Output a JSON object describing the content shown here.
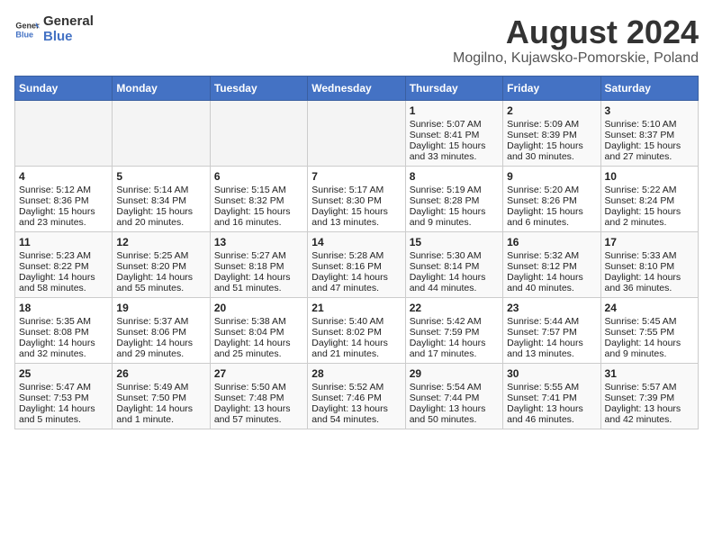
{
  "header": {
    "logo_general": "General",
    "logo_blue": "Blue",
    "main_title": "August 2024",
    "subtitle": "Mogilno, Kujawsko-Pomorskie, Poland"
  },
  "weekdays": [
    "Sunday",
    "Monday",
    "Tuesday",
    "Wednesday",
    "Thursday",
    "Friday",
    "Saturday"
  ],
  "weeks": [
    [
      {
        "day": "",
        "info": ""
      },
      {
        "day": "",
        "info": ""
      },
      {
        "day": "",
        "info": ""
      },
      {
        "day": "",
        "info": ""
      },
      {
        "day": "1",
        "info": "Sunrise: 5:07 AM\nSunset: 8:41 PM\nDaylight: 15 hours\nand 33 minutes."
      },
      {
        "day": "2",
        "info": "Sunrise: 5:09 AM\nSunset: 8:39 PM\nDaylight: 15 hours\nand 30 minutes."
      },
      {
        "day": "3",
        "info": "Sunrise: 5:10 AM\nSunset: 8:37 PM\nDaylight: 15 hours\nand 27 minutes."
      }
    ],
    [
      {
        "day": "4",
        "info": "Sunrise: 5:12 AM\nSunset: 8:36 PM\nDaylight: 15 hours\nand 23 minutes."
      },
      {
        "day": "5",
        "info": "Sunrise: 5:14 AM\nSunset: 8:34 PM\nDaylight: 15 hours\nand 20 minutes."
      },
      {
        "day": "6",
        "info": "Sunrise: 5:15 AM\nSunset: 8:32 PM\nDaylight: 15 hours\nand 16 minutes."
      },
      {
        "day": "7",
        "info": "Sunrise: 5:17 AM\nSunset: 8:30 PM\nDaylight: 15 hours\nand 13 minutes."
      },
      {
        "day": "8",
        "info": "Sunrise: 5:19 AM\nSunset: 8:28 PM\nDaylight: 15 hours\nand 9 minutes."
      },
      {
        "day": "9",
        "info": "Sunrise: 5:20 AM\nSunset: 8:26 PM\nDaylight: 15 hours\nand 6 minutes."
      },
      {
        "day": "10",
        "info": "Sunrise: 5:22 AM\nSunset: 8:24 PM\nDaylight: 15 hours\nand 2 minutes."
      }
    ],
    [
      {
        "day": "11",
        "info": "Sunrise: 5:23 AM\nSunset: 8:22 PM\nDaylight: 14 hours\nand 58 minutes."
      },
      {
        "day": "12",
        "info": "Sunrise: 5:25 AM\nSunset: 8:20 PM\nDaylight: 14 hours\nand 55 minutes."
      },
      {
        "day": "13",
        "info": "Sunrise: 5:27 AM\nSunset: 8:18 PM\nDaylight: 14 hours\nand 51 minutes."
      },
      {
        "day": "14",
        "info": "Sunrise: 5:28 AM\nSunset: 8:16 PM\nDaylight: 14 hours\nand 47 minutes."
      },
      {
        "day": "15",
        "info": "Sunrise: 5:30 AM\nSunset: 8:14 PM\nDaylight: 14 hours\nand 44 minutes."
      },
      {
        "day": "16",
        "info": "Sunrise: 5:32 AM\nSunset: 8:12 PM\nDaylight: 14 hours\nand 40 minutes."
      },
      {
        "day": "17",
        "info": "Sunrise: 5:33 AM\nSunset: 8:10 PM\nDaylight: 14 hours\nand 36 minutes."
      }
    ],
    [
      {
        "day": "18",
        "info": "Sunrise: 5:35 AM\nSunset: 8:08 PM\nDaylight: 14 hours\nand 32 minutes."
      },
      {
        "day": "19",
        "info": "Sunrise: 5:37 AM\nSunset: 8:06 PM\nDaylight: 14 hours\nand 29 minutes."
      },
      {
        "day": "20",
        "info": "Sunrise: 5:38 AM\nSunset: 8:04 PM\nDaylight: 14 hours\nand 25 minutes."
      },
      {
        "day": "21",
        "info": "Sunrise: 5:40 AM\nSunset: 8:02 PM\nDaylight: 14 hours\nand 21 minutes."
      },
      {
        "day": "22",
        "info": "Sunrise: 5:42 AM\nSunset: 7:59 PM\nDaylight: 14 hours\nand 17 minutes."
      },
      {
        "day": "23",
        "info": "Sunrise: 5:44 AM\nSunset: 7:57 PM\nDaylight: 14 hours\nand 13 minutes."
      },
      {
        "day": "24",
        "info": "Sunrise: 5:45 AM\nSunset: 7:55 PM\nDaylight: 14 hours\nand 9 minutes."
      }
    ],
    [
      {
        "day": "25",
        "info": "Sunrise: 5:47 AM\nSunset: 7:53 PM\nDaylight: 14 hours\nand 5 minutes."
      },
      {
        "day": "26",
        "info": "Sunrise: 5:49 AM\nSunset: 7:50 PM\nDaylight: 14 hours\nand 1 minute."
      },
      {
        "day": "27",
        "info": "Sunrise: 5:50 AM\nSunset: 7:48 PM\nDaylight: 13 hours\nand 57 minutes."
      },
      {
        "day": "28",
        "info": "Sunrise: 5:52 AM\nSunset: 7:46 PM\nDaylight: 13 hours\nand 54 minutes."
      },
      {
        "day": "29",
        "info": "Sunrise: 5:54 AM\nSunset: 7:44 PM\nDaylight: 13 hours\nand 50 minutes."
      },
      {
        "day": "30",
        "info": "Sunrise: 5:55 AM\nSunset: 7:41 PM\nDaylight: 13 hours\nand 46 minutes."
      },
      {
        "day": "31",
        "info": "Sunrise: 5:57 AM\nSunset: 7:39 PM\nDaylight: 13 hours\nand 42 minutes."
      }
    ]
  ]
}
